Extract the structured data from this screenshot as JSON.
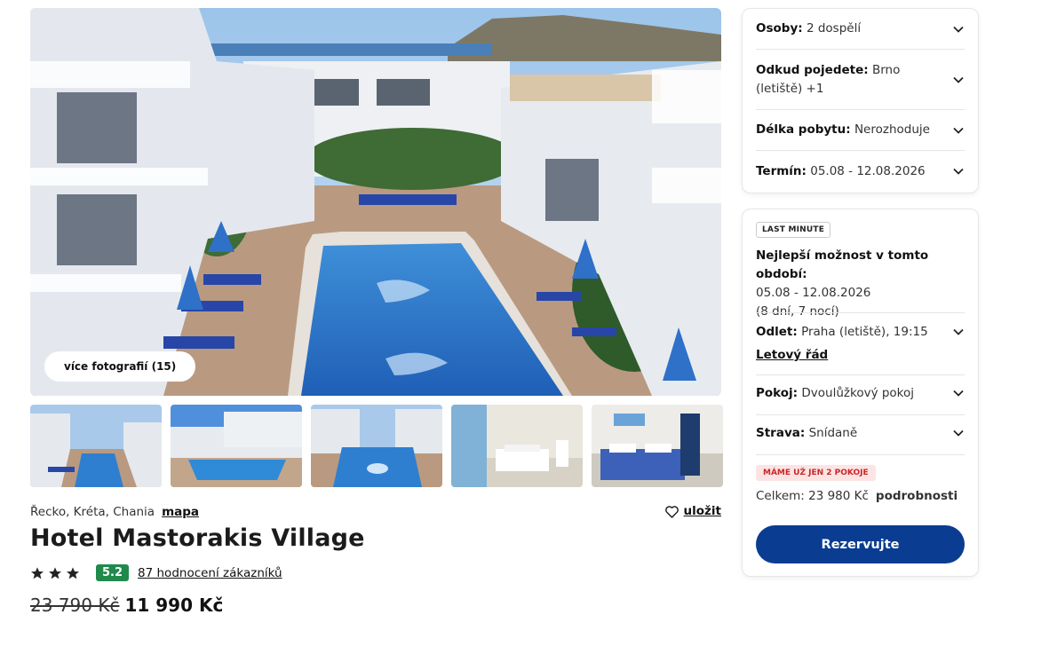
{
  "gallery": {
    "more_photos_label": "více fotografií (15)",
    "thumbnail_count": 5
  },
  "hotel": {
    "location": "Řecko, Kréta, Chania",
    "map_link": "mapa",
    "save_label": "uložit",
    "name": "Hotel Mastorakis Village",
    "stars": 3,
    "score": "5.2",
    "reviews_link": "87 hodnocení zákazníků",
    "old_price": "23 790 Kč",
    "new_price": "11 990 Kč"
  },
  "search": {
    "persons_label": "Osoby:",
    "persons_value": "2 dospělí",
    "departure_label": "Odkud pojedete:",
    "departure_value_line1": "Brno",
    "departure_value_line2": "(letiště) +1",
    "length_label": "Délka pobytu:",
    "length_value": "Nerozhoduje",
    "term_label": "Termín:",
    "term_value": "05.08 - 12.08.2026"
  },
  "offer": {
    "badge": "LAST MINUTE",
    "best_title": "Nejlepší možnost v tomto období:",
    "best_dates": "05.08 - 12.08.2026",
    "best_nights": "(8 dní, 7 nocí)",
    "departure_label": "Odlet:",
    "departure_value": "Praha (letiště), 19:15",
    "flight_link": "Letový řád",
    "room_label": "Pokoj:",
    "room_value": "Dvoulůžkový pokoj",
    "board_label": "Strava:",
    "board_value": "Snídaně",
    "rooms_badge": "MÁME UŽ JEN 2 POKOJE",
    "total_label": "Celkem: 23 980 Kč",
    "details_link": "podrobnosti",
    "book_button": "Rezervujte"
  },
  "colors": {
    "primary_button": "#0a3d91",
    "score_badge": "#1f8a4c",
    "rooms_badge_text": "#c62828",
    "rooms_badge_bg": "#fde4e4"
  }
}
